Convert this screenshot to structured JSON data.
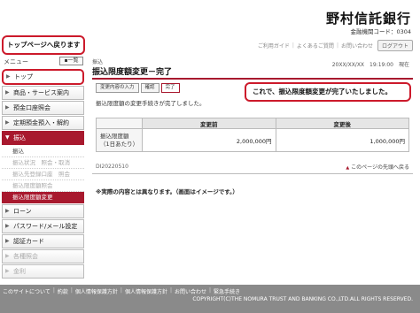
{
  "header": {
    "bank_name": "野村信託銀行",
    "bank_code": "金融機関コード：0304",
    "links": [
      "ご利用ガイド",
      "よくあるご質問",
      "お問い合わせ"
    ],
    "logout_label": "ログアウト"
  },
  "callouts": {
    "top_page": "トップページへ戻ります",
    "completed": "これで、振込限度額変更が完了いたしました。"
  },
  "sidebar": {
    "menu_label": "メニュー",
    "list_button": "一覧",
    "items": [
      {
        "label": "トップ",
        "state": "highlighted"
      },
      {
        "label": "商品・サービス案内",
        "state": "normal"
      },
      {
        "label": "預金口座照会",
        "state": "normal"
      },
      {
        "label": "定期預金預入・解約",
        "state": "normal"
      },
      {
        "label": "振込",
        "state": "active"
      },
      {
        "label": "ローン",
        "state": "normal"
      },
      {
        "label": "パスワード/メール設定",
        "state": "normal"
      },
      {
        "label": "認証カード",
        "state": "normal"
      },
      {
        "label": "各種照会",
        "state": "disabled"
      },
      {
        "label": "金利",
        "state": "disabled"
      }
    ],
    "sub_items": [
      {
        "label": "振込",
        "state": "normal"
      },
      {
        "label": "振込状況　照会・取消",
        "state": "dim"
      },
      {
        "label": "振込先登録口座　照会",
        "state": "dim"
      },
      {
        "label": "振込限度額照会",
        "state": "dim"
      },
      {
        "label": "振込限度額変更",
        "state": "current"
      }
    ]
  },
  "main": {
    "section_label": "振込",
    "title": "振込限度額変更－完了",
    "datetime": "20XX/XX/XX　19:19:00　現在",
    "steps": [
      "変更内容の入力",
      "確認",
      "完了"
    ],
    "intro": "振込限度額の変更手続きが完了しました。",
    "table": {
      "headers": [
        "",
        "変更前",
        "変更後"
      ],
      "row_label_line1": "振込限度額",
      "row_label_line2": "（1日あたり）",
      "before": "2,000,000円",
      "after": "1,000,000円"
    },
    "reference_no": "DI20220510",
    "page_top_link": "このページの先頭へ戻る",
    "note": "※実際の内容とは異なります。（画面はイメージです。）"
  },
  "footer": {
    "links": [
      "このサイトについて",
      "約款",
      "個人情報保護方針",
      "個人情報保護方針",
      "お問い合わせ",
      "緊急手続き"
    ],
    "copyright": "COPYRIGHT(C)THE NOMURA TRUST AND BANKING CO.,LTD.ALL RIGHTS RESERVED."
  },
  "colors": {
    "accent": "#a8192e",
    "callout_border": "#cc1a2b",
    "footer_bg": "#8a8a8a"
  }
}
